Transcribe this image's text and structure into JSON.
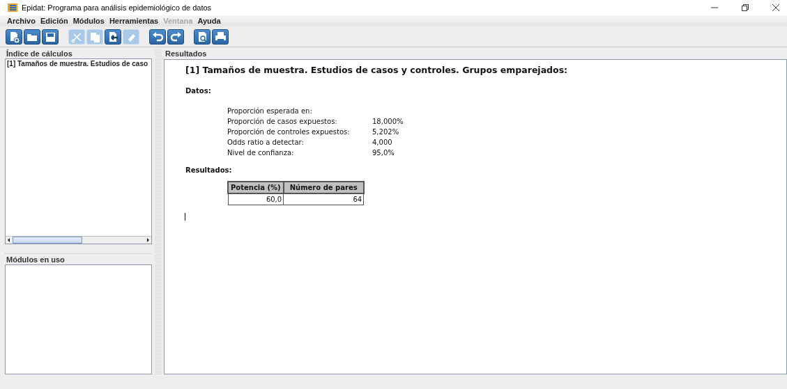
{
  "window": {
    "title": "Epidat: Programa para análisis epidemiológico de datos"
  },
  "menu": [
    {
      "label": "Archivo",
      "disabled": false
    },
    {
      "label": "Edición",
      "disabled": false
    },
    {
      "label": "Módulos",
      "disabled": false
    },
    {
      "label": "Herramientas",
      "disabled": false
    },
    {
      "label": "Ventana",
      "disabled": true
    },
    {
      "label": "Ayuda",
      "disabled": false
    }
  ],
  "toolbar": [
    [
      {
        "kind": "new",
        "disabled": false
      },
      {
        "kind": "open",
        "disabled": false
      },
      {
        "kind": "save",
        "disabled": false
      }
    ],
    [
      {
        "kind": "cut",
        "disabled": true
      },
      {
        "kind": "copy",
        "disabled": true
      },
      {
        "kind": "paste",
        "disabled": false
      },
      {
        "kind": "erase",
        "disabled": true
      }
    ],
    [
      {
        "kind": "undo",
        "disabled": false
      },
      {
        "kind": "redo",
        "disabled": false
      }
    ],
    [
      {
        "kind": "preview",
        "disabled": false
      },
      {
        "kind": "print",
        "disabled": false
      }
    ]
  ],
  "index_panel": {
    "title": "Índice de cálculos",
    "items": [
      {
        "label": "[1] Tamaños de muestra. Estudios de caso",
        "selected": false
      }
    ]
  },
  "modules_panel": {
    "title": "Módulos en uso"
  },
  "results_panel": {
    "title": "Resultados",
    "heading": "[1] Tamaños de muestra. Estudios de casos y controles. Grupos emparejados:",
    "data_heading": "Datos:",
    "data_rows": [
      {
        "label": "Proporción esperada en:"
      },
      {
        "label": "Proporción de casos expuestos:",
        "value": "18,000%"
      },
      {
        "label": "Proporción de controles expuestos:",
        "value": "5,202%"
      },
      {
        "label": "Odds ratio a detectar:",
        "value": "4,000"
      },
      {
        "label": "Nivel de confianza:",
        "value": "95,0%"
      }
    ],
    "results_heading": "Resultados:",
    "table": {
      "columns": [
        "Potencia (%)",
        "Número de pares"
      ],
      "rows": [
        [
          "60,0",
          "64"
        ]
      ]
    }
  }
}
